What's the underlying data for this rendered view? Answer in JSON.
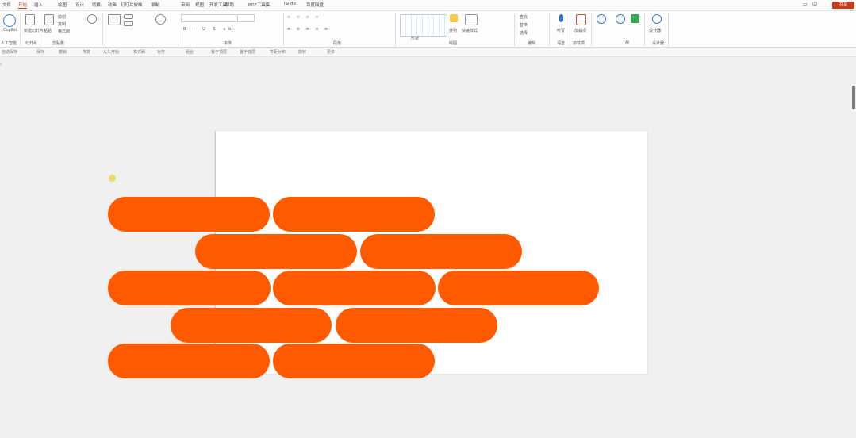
{
  "menu": {
    "tabs": [
      "文件",
      "开始",
      "插入",
      "绘图",
      "设计",
      "切换",
      "动画",
      "幻灯片放映",
      "录制",
      "审阅",
      "视图",
      "开发工具",
      "帮助",
      "PDF工具集",
      "iSlide",
      "百度网盘"
    ],
    "active_index": 1,
    "share_label": "共享"
  },
  "ribbon": {
    "groups": [
      {
        "label": "人工智能"
      },
      {
        "label": "幻灯片"
      },
      {
        "label": "剪贴板"
      },
      {
        "label": "字体"
      },
      {
        "label": "段落"
      },
      {
        "label": "绘图"
      },
      {
        "label": "编辑"
      },
      {
        "label": "语音"
      },
      {
        "label": "加载项"
      },
      {
        "label": "AI"
      },
      {
        "label": "设计器"
      }
    ],
    "buttons": {
      "ai": "Copilot",
      "new_slide": "新建幻灯片",
      "paste": "粘贴",
      "cut": "剪切",
      "copy": "复制",
      "format_painter": "格式刷",
      "shapes": "形状",
      "arrange": "排列",
      "quick_styles": "快速样式",
      "find": "查找",
      "replace": "替换",
      "select": "选择",
      "dictate": "听写",
      "addins": "加载项",
      "designer": "设计器"
    }
  },
  "qat": {
    "items": [
      "自动保存",
      "保存",
      "撤销",
      "恢复",
      "从头开始",
      "格式刷",
      "对齐",
      "组合",
      "置于顶层",
      "置于底层",
      "等距分布",
      "旋转",
      "更多"
    ]
  },
  "colors": {
    "accent": "#c43e1c",
    "shape_fill": "#ff5a00",
    "cursor": "#f2d34f"
  },
  "slide": {
    "shapes_count_rows": [
      2,
      2,
      3,
      2,
      2
    ]
  }
}
